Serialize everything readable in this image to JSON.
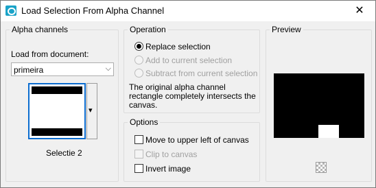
{
  "window": {
    "title": "Load Selection From Alpha Channel",
    "close_glyph": "✕"
  },
  "alpha_channels": {
    "legend": "Alpha channels",
    "load_from_label": "Load from document:",
    "document_select": {
      "value": "primeira",
      "arrow": "⌵"
    },
    "channel_name": "Selectie 2",
    "dropdown_arrow": "▾"
  },
  "operation": {
    "legend": "Operation",
    "options": [
      {
        "label": "Replace selection",
        "checked": true,
        "enabled": true
      },
      {
        "label": "Add to current selection",
        "checked": false,
        "enabled": false
      },
      {
        "label": "Subtract from current selection",
        "checked": false,
        "enabled": false
      }
    ],
    "message": "The original alpha channel rectangle completely intersects the canvas."
  },
  "options": {
    "legend": "Options",
    "items": [
      {
        "label": "Move to upper left of canvas",
        "checked": false,
        "enabled": true
      },
      {
        "label": "Clip to canvas",
        "checked": false,
        "enabled": false
      },
      {
        "label": "Invert image",
        "checked": false,
        "enabled": true
      }
    ]
  },
  "preview": {
    "legend": "Preview"
  },
  "colors": {
    "accent": "#1aa3c8",
    "selection_border": "#0a6ccf"
  }
}
